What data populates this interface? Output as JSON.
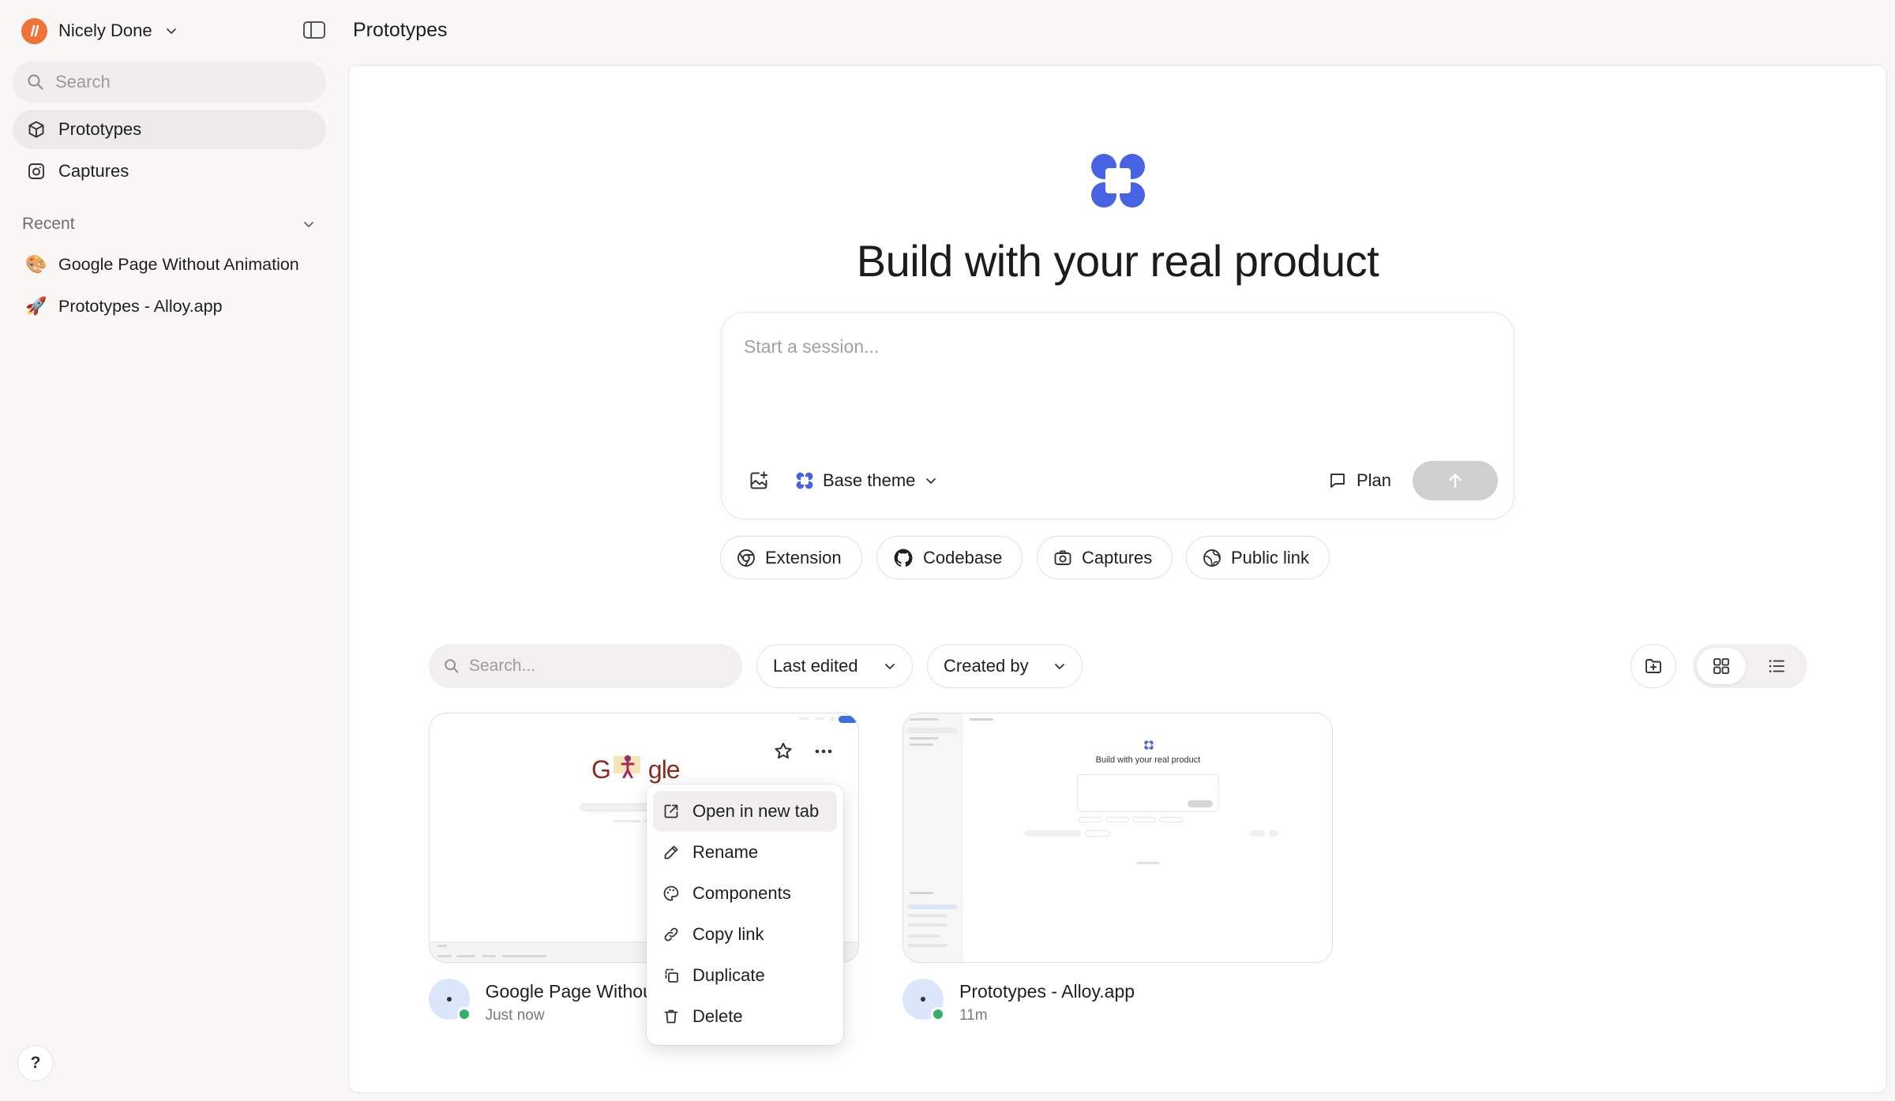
{
  "sidebar": {
    "workspace_name": "Nicely Done",
    "search_placeholder": "Search",
    "nav": [
      {
        "label": "Prototypes",
        "icon": "cube-icon",
        "active": true
      },
      {
        "label": "Captures",
        "icon": "camera-icon",
        "active": false
      }
    ],
    "recent_label": "Recent",
    "recent": [
      {
        "emoji": "🎨",
        "label": "Google Page Without Animation"
      },
      {
        "emoji": "🚀",
        "label": "Prototypes - Alloy.app"
      }
    ],
    "help_label": "?"
  },
  "header": {
    "title": "Prototypes"
  },
  "hero": {
    "title": "Build with your real product",
    "composer_placeholder": "Start a session...",
    "theme_label": "Base theme",
    "plan_label": "Plan"
  },
  "sources": [
    {
      "label": "Extension",
      "icon": "chrome-icon"
    },
    {
      "label": "Codebase",
      "icon": "github-icon"
    },
    {
      "label": "Captures",
      "icon": "camera-icon"
    },
    {
      "label": "Public link",
      "icon": "globe-icon"
    }
  ],
  "filters": {
    "search_placeholder": "Search...",
    "sort_label": "Last edited",
    "creator_label": "Created by"
  },
  "projects": [
    {
      "title": "Google Page Without Animation",
      "title_visible": "Google Page Withou",
      "time": "Just now",
      "thumb_logo": "G",
      "thumb_logo_end": "gle"
    },
    {
      "title": "Prototypes - Alloy.app",
      "time": "11m",
      "thumb_heading": "Build with your real product"
    }
  ],
  "context_menu": [
    {
      "label": "Open in new tab",
      "icon": "external-link-icon"
    },
    {
      "label": "Rename",
      "icon": "pencil-icon"
    },
    {
      "label": "Components",
      "icon": "palette-icon"
    },
    {
      "label": "Copy link",
      "icon": "link-icon"
    },
    {
      "label": "Duplicate",
      "icon": "duplicate-icon"
    },
    {
      "label": "Delete",
      "icon": "trash-icon"
    }
  ],
  "colors": {
    "brand_blue": "#4763e4",
    "workspace_orange": "#f07238",
    "online_green": "#2fb36b"
  }
}
